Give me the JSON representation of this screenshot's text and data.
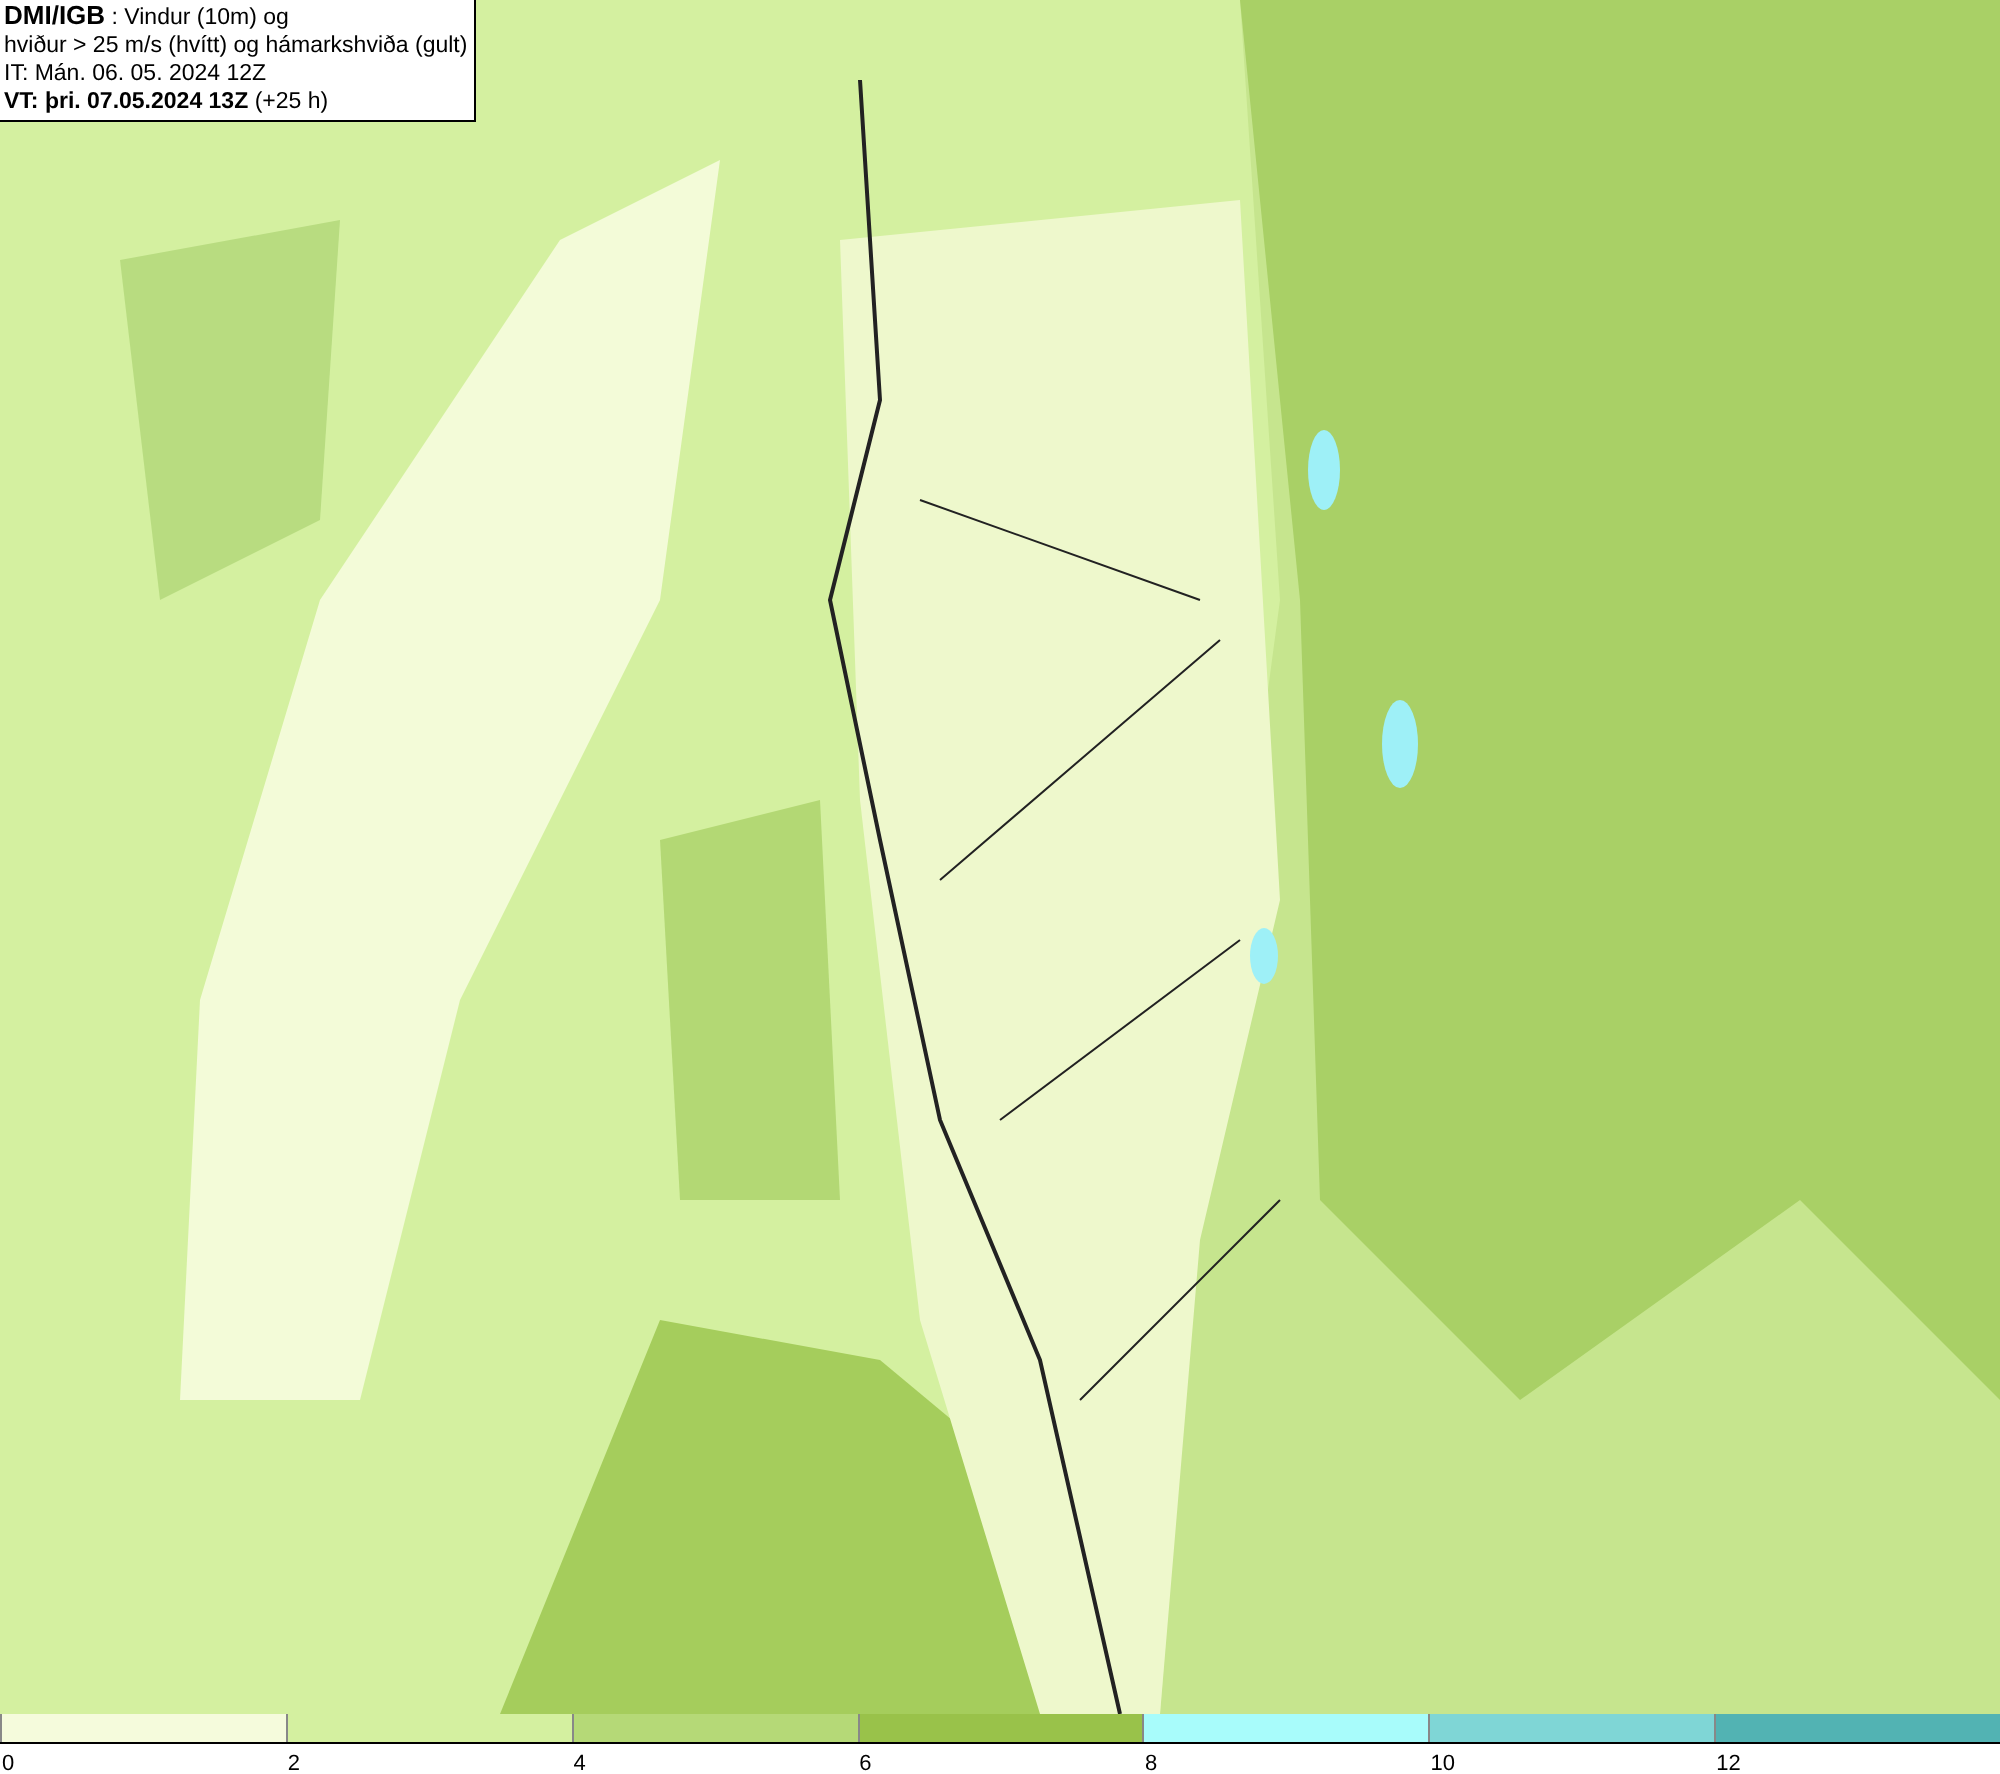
{
  "header": {
    "source": "DMI/IGB",
    "title": ": Vindur (10m) og",
    "subtitle": "hviður > 25 m/s (hvítt) og hámarkshviða (gult)",
    "initial_time": "IT: Mán. 06. 05. 2024 12Z",
    "valid_time": "VT: þri. 07.05.2024 13Z",
    "lead": "(+25 h)"
  },
  "legend": [
    {
      "label": "0",
      "color": "#f5fbdc"
    },
    {
      "label": "2",
      "color": "#d4f0a0"
    },
    {
      "label": "4",
      "color": "#b5d977"
    },
    {
      "label": "6",
      "color": "#99c24a"
    },
    {
      "label": "8",
      "color": "#a8fcfb"
    },
    {
      "label": "10",
      "color": "#7fd6d6"
    },
    {
      "label": "12",
      "color": "#52b3b3"
    }
  ]
}
